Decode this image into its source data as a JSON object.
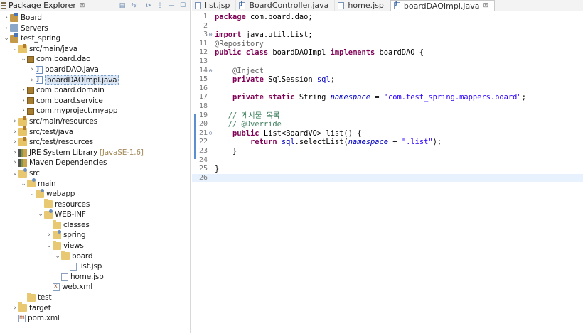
{
  "explorer": {
    "title": "Package Explorer",
    "close": "⊠"
  },
  "tree": [
    {
      "indent": 0,
      "tw": "›",
      "icon": "project",
      "label": "Board",
      "name": "tree-item-board"
    },
    {
      "indent": 0,
      "tw": "›",
      "icon": "servers",
      "label": "Servers",
      "name": "tree-item-servers"
    },
    {
      "indent": 0,
      "tw": "⌄",
      "icon": "project",
      "label": "test_spring",
      "name": "tree-item-test-spring"
    },
    {
      "indent": 1,
      "tw": "⌄",
      "icon": "srcfolder",
      "label": "src/main/java",
      "name": "tree-item-src-main-java"
    },
    {
      "indent": 2,
      "tw": "⌄",
      "icon": "package",
      "label": "com.board.dao",
      "name": "tree-item-com-board-dao"
    },
    {
      "indent": 3,
      "tw": "›",
      "icon": "java",
      "label": "boardDAO.java",
      "name": "tree-item-boarddao-java"
    },
    {
      "indent": 3,
      "tw": "›",
      "icon": "java",
      "label": "boardDAOImpl.java",
      "name": "tree-item-boarddaoimpl-java",
      "selected": true
    },
    {
      "indent": 2,
      "tw": "›",
      "icon": "package",
      "label": "com.board.domain",
      "name": "tree-item-com-board-domain"
    },
    {
      "indent": 2,
      "tw": "›",
      "icon": "package",
      "label": "com.board.service",
      "name": "tree-item-com-board-service"
    },
    {
      "indent": 2,
      "tw": "›",
      "icon": "package",
      "label": "com.myproject.myapp",
      "name": "tree-item-com-myproject-myapp"
    },
    {
      "indent": 1,
      "tw": "›",
      "icon": "srcfolder",
      "label": "src/main/resources",
      "name": "tree-item-src-main-resources"
    },
    {
      "indent": 1,
      "tw": "›",
      "icon": "srcfolder",
      "label": "src/test/java",
      "name": "tree-item-src-test-java"
    },
    {
      "indent": 1,
      "tw": "›",
      "icon": "srcfolder",
      "label": "src/test/resources",
      "name": "tree-item-src-test-resources"
    },
    {
      "indent": 1,
      "tw": "›",
      "icon": "lib",
      "label": "JRE System Library",
      "deco": "[JavaSE-1.6]",
      "name": "tree-item-jre-system-library"
    },
    {
      "indent": 1,
      "tw": "›",
      "icon": "lib",
      "label": "Maven Dependencies",
      "name": "tree-item-maven-dependencies"
    },
    {
      "indent": 1,
      "tw": "⌄",
      "icon": "webfolder",
      "label": "src",
      "name": "tree-item-src"
    },
    {
      "indent": 2,
      "tw": "⌄",
      "icon": "webfolder",
      "label": "main",
      "name": "tree-item-main"
    },
    {
      "indent": 3,
      "tw": "⌄",
      "icon": "webfolder",
      "label": "webapp",
      "name": "tree-item-webapp"
    },
    {
      "indent": 4,
      "tw": "",
      "icon": "folder",
      "label": "resources",
      "name": "tree-item-resources"
    },
    {
      "indent": 4,
      "tw": "⌄",
      "icon": "webfolder",
      "label": "WEB-INF",
      "name": "tree-item-web-inf"
    },
    {
      "indent": 5,
      "tw": "",
      "icon": "folder",
      "label": "classes",
      "name": "tree-item-classes"
    },
    {
      "indent": 5,
      "tw": "›",
      "icon": "webfolder",
      "label": "spring",
      "name": "tree-item-spring"
    },
    {
      "indent": 5,
      "tw": "⌄",
      "icon": "folder",
      "label": "views",
      "name": "tree-item-views"
    },
    {
      "indent": 6,
      "tw": "⌄",
      "icon": "folder",
      "label": "board",
      "name": "tree-item-board-folder"
    },
    {
      "indent": 7,
      "tw": "",
      "icon": "file",
      "label": "list.jsp",
      "name": "tree-item-list-jsp"
    },
    {
      "indent": 6,
      "tw": "",
      "icon": "file",
      "label": "home.jsp",
      "name": "tree-item-home-jsp"
    },
    {
      "indent": 5,
      "tw": "",
      "icon": "xml",
      "label": "web.xml",
      "name": "tree-item-web-xml"
    },
    {
      "indent": 2,
      "tw": "",
      "icon": "folder",
      "label": "test",
      "name": "tree-item-test"
    },
    {
      "indent": 1,
      "tw": "›",
      "icon": "folder",
      "label": "target",
      "name": "tree-item-target"
    },
    {
      "indent": 1,
      "tw": "",
      "icon": "pom",
      "label": "pom.xml",
      "name": "tree-item-pom-xml"
    }
  ],
  "tabs": [
    {
      "label": "list.jsp",
      "icon": "file",
      "active": false
    },
    {
      "label": "BoardController.java",
      "icon": "java",
      "active": false
    },
    {
      "label": "home.jsp",
      "icon": "file",
      "active": false
    },
    {
      "label": "boardDAOImpl.java",
      "icon": "java",
      "active": true,
      "close": "⊠"
    }
  ],
  "code": [
    {
      "n": "1",
      "fold": "",
      "html": "<span class=\"kw\">package</span> com.board.dao;"
    },
    {
      "n": "2",
      "fold": "",
      "html": ""
    },
    {
      "n": "3",
      "fold": "⊕",
      "html": "<span class=\"kw\">import</span> java.util.List;"
    },
    {
      "n": "11",
      "fold": "",
      "html": "<span class=\"ann\">@Repository</span>"
    },
    {
      "n": "12",
      "fold": "",
      "html": "<span class=\"kw\">public class</span> boardDAOImpl <span class=\"kw\">implements</span> boardDAO {"
    },
    {
      "n": "13",
      "fold": "",
      "html": ""
    },
    {
      "n": "14",
      "fold": "⊖",
      "html": "    <span class=\"ann\">@Inject</span>"
    },
    {
      "n": "15",
      "fold": "",
      "html": "    <span class=\"kw\">private</span> SqlSession <span class=\"fld\">sql</span>;"
    },
    {
      "n": "16",
      "fold": "",
      "html": ""
    },
    {
      "n": "17",
      "fold": "",
      "html": "    <span class=\"kw\">private static</span> String <span class=\"sfld\">namespace</span> = <span class=\"str\">\"com.test_spring.mappers.board\"</span>;"
    },
    {
      "n": "18",
      "fold": "",
      "html": ""
    },
    {
      "n": "19",
      "fold": "",
      "html": "   <span class=\"cm\">// 게시물 목록</span>"
    },
    {
      "n": "20",
      "fold": "",
      "html": "   <span class=\"cm\">// @Override</span>"
    },
    {
      "n": "21",
      "fold": "⊖",
      "html": "    <span class=\"kw\">public</span> List&lt;BoardVO&gt; list() {"
    },
    {
      "n": "22",
      "fold": "",
      "html": "        <span class=\"kw\">return</span> <span class=\"fld\">sql</span>.selectList(<span class=\"sfld\">namespace</span> + <span class=\"str\">\".list\"</span>);"
    },
    {
      "n": "23",
      "fold": "",
      "html": "    }"
    },
    {
      "n": "24",
      "fold": "",
      "html": ""
    },
    {
      "n": "25",
      "fold": "",
      "html": "}"
    },
    {
      "n": "26",
      "fold": "",
      "html": "",
      "current": true
    }
  ]
}
